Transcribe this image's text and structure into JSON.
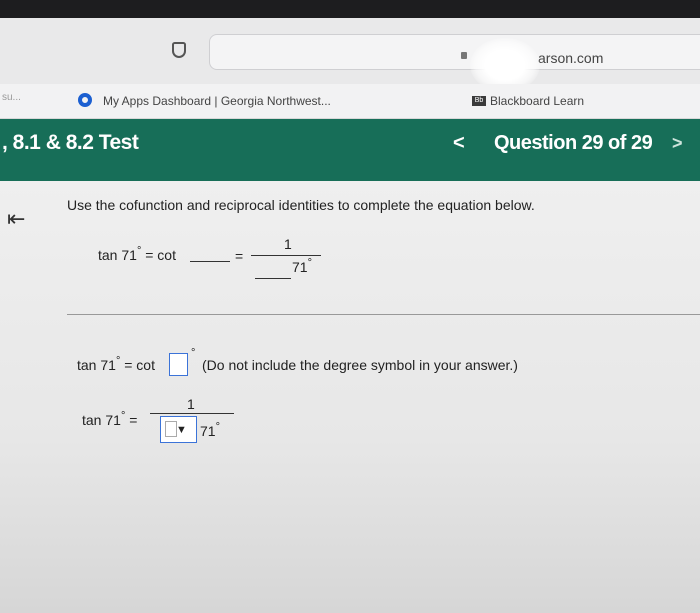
{
  "browser": {
    "url": "arson.com",
    "bookmarks": [
      {
        "label": "My Apps Dashboard | Georgia Northwest..."
      },
      {
        "label": "Blackboard Learn"
      }
    ],
    "bookmark_left_stub": "su..."
  },
  "header": {
    "title": ", 8.1 & 8.2 Test",
    "question_label": "Question 29 of 29",
    "prev_glyph": "<",
    "next_glyph": ">"
  },
  "question": {
    "instruction": "Use the cofunction and reciprocal identities to complete the equation below.",
    "eq_lhs": "tan 71",
    "eq_sep1": " = cot",
    "eq_equals": "=",
    "numerator": "1",
    "denominator": "71",
    "degree": "°"
  },
  "answer": {
    "line1_lhs": "tan 71",
    "line1_mid": " = cot",
    "note": "(Do not include the degree symbol in your answer.)",
    "box_value": "",
    "line2_lhs": "tan 71",
    "line2_eq": " =",
    "line2_num": "1",
    "line2_den": "71",
    "dropdown_selected": ""
  }
}
